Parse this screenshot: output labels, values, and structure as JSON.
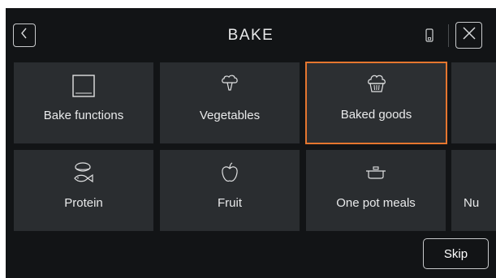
{
  "header": {
    "title": "BAKE",
    "back_icon": "chevron-left-icon",
    "device_icon": "phone-icon",
    "close_icon": "close-icon"
  },
  "tiles": [
    {
      "label": "Bake functions",
      "icon": "oven-icon",
      "selected": false
    },
    {
      "label": "Vegetables",
      "icon": "broccoli-icon",
      "selected": false
    },
    {
      "label": "Baked goods",
      "icon": "muffin-icon",
      "selected": true
    },
    {
      "label": "",
      "icon": "",
      "selected": false
    },
    {
      "label": "Protein",
      "icon": "fish-icon",
      "selected": false
    },
    {
      "label": "Fruit",
      "icon": "apple-icon",
      "selected": false
    },
    {
      "label": "One pot meals",
      "icon": "pot-icon",
      "selected": false
    },
    {
      "label": "Nu",
      "icon": "",
      "selected": false
    }
  ],
  "footer": {
    "skip_label": "Skip"
  },
  "colors": {
    "background": "#121416",
    "tile": "#2a2d30",
    "accent": "#e5762f",
    "text": "#e9eaeb"
  }
}
